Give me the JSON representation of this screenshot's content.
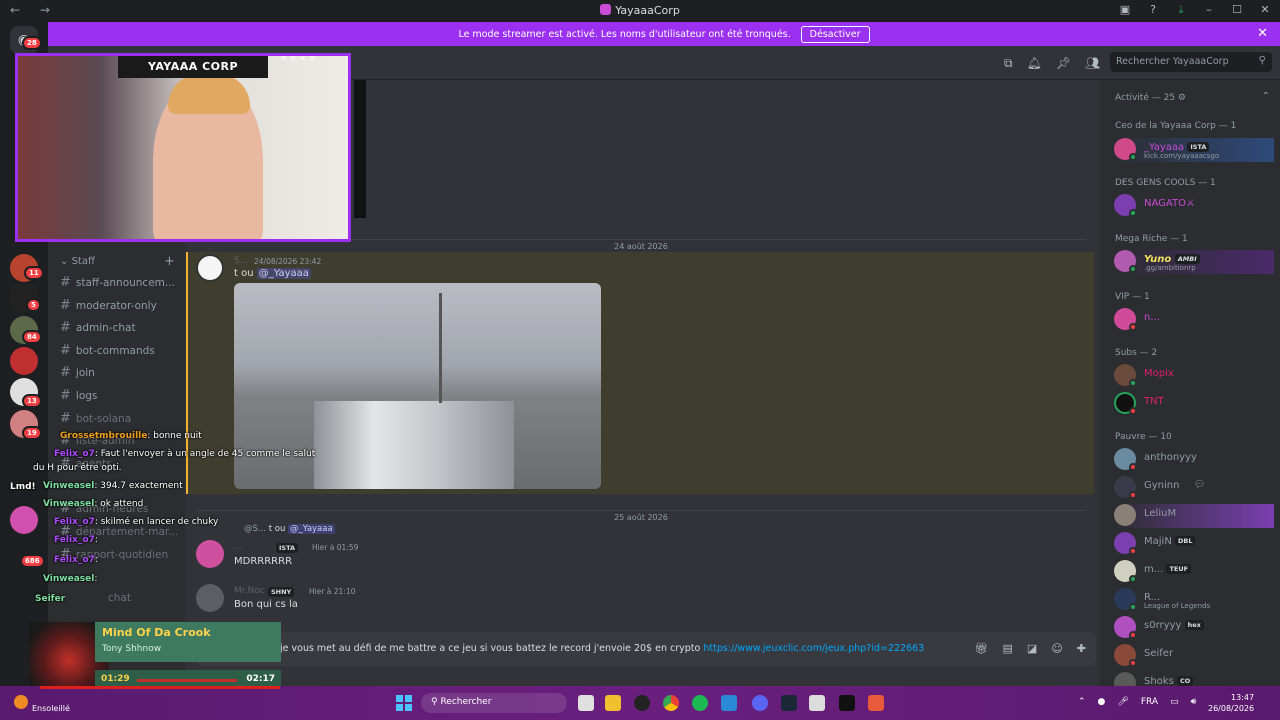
{
  "window": {
    "title": "YayaaaCorp",
    "nav": "←  →"
  },
  "banner": {
    "text": "Le mode streamer est activé. Les noms d'utilisateur ont été tronqués.",
    "button": "Désactiver"
  },
  "guilds": {
    "home_badge": "28",
    "badges": [
      "11",
      "5",
      "84",
      "13",
      "19",
      "686"
    ]
  },
  "channels": {
    "category": "Staff",
    "items": [
      "staff-announcem...",
      "moderator-only",
      "admin-chat",
      "bot-commands",
      "join",
      "logs",
      "bot-solana",
      "liste-admin",
      "agents",
      "admin-heures",
      "département-mar...",
      "rapport-quotidien",
      "chat"
    ]
  },
  "search": {
    "placeholder": "Rechercher YayaaaCorp"
  },
  "messages": {
    "date1": "24 août 2026",
    "date2": "25 août 2026",
    "m1": {
      "user": "S...",
      "time": "24/08/2026 23:42",
      "text_pre": "t ou ",
      "mention": "@_Yayaaa"
    },
    "m2": {
      "reply_user": "@S...",
      "reply_text": "t ou ",
      "reply_mention": "@_Yayaaa",
      "user": "...",
      "tag": "ISTA",
      "time": "Hier à 01:59",
      "text": "MDRRRRRR"
    },
    "m3": {
      "user": "Mr.Noc",
      "tag": "SHNY",
      "time": "Hier à 21:10",
      "text": "Bon qui cs la"
    }
  },
  "composer": {
    "text": "je vous met au défi de me battre a ce jeu si vous battez le record j'envoie 20$ en crypto ",
    "link": "https://www.jeuxclic.com/jeux.php?id=222663"
  },
  "members": {
    "activity": "Activité — 25",
    "groups": [
      {
        "header": "Ceo de la Yayaaa Corp — 1"
      },
      {
        "header": "DES GENS COOLS — 1"
      },
      {
        "header": "Mega Riche — 1"
      },
      {
        "header": "VIP — 1"
      },
      {
        "header": "Subs — 2"
      },
      {
        "header": "Pauvre — 10"
      }
    ],
    "rows": [
      {
        "name": "_Yayaaa",
        "tag": "ISTA",
        "sub": "kick.com/yayaaacsgo",
        "color": "#c94bd6"
      },
      {
        "name": "NAGATO⚔",
        "color": "#c94bd6"
      },
      {
        "name": "Yuno",
        "tag": "AMBI",
        "sub": ".gg/ambitionrp",
        "color": "#f0e05a"
      },
      {
        "name": "n...",
        "color": "#c94bd6"
      },
      {
        "name": "Mopix",
        "color": "#e0206a"
      },
      {
        "name": "TNT",
        "color": "#e0206a"
      },
      {
        "name": "anthonyyy",
        "color": "#949ba4"
      },
      {
        "name": "Gyninn",
        "color": "#949ba4"
      },
      {
        "name": "LeliuM",
        "color": "#949ba4"
      },
      {
        "name": "MajiN",
        "tag": "DBL",
        "color": "#949ba4"
      },
      {
        "name": "m...",
        "tag": "TEUF",
        "color": "#949ba4"
      },
      {
        "name": "R...",
        "sub": "League of Legends",
        "color": "#949ba4"
      },
      {
        "name": "s0rryyy",
        "tag": "hex",
        "color": "#949ba4"
      },
      {
        "name": "Seifer",
        "color": "#949ba4"
      },
      {
        "name": "Shoks",
        "tag": "CO",
        "color": "#949ba4"
      }
    ]
  },
  "overlay": {
    "webcam_title": "YAYAAA CORP",
    "chat": [
      {
        "user": "Grossetmbrouille",
        "text": ": bonne nuit",
        "color": "#f0a020"
      },
      {
        "user": "Felix_o7",
        "text": ": Faut l'envoyer à un angle de 45 comme le salut",
        "color": "#b04cff"
      },
      {
        "user": "",
        "text": "du H pour être opti.",
        "color": "#fff"
      },
      {
        "user": "Vinweasel",
        "text": ": 394.7 exactement",
        "color": "#7de0a0"
      },
      {
        "user": "Vinweasel",
        "text": ": ok attend",
        "color": "#7de0a0"
      },
      {
        "user": "Felix_o7",
        "text": ": skilmé en lancer de chuky",
        "color": "#b04cff"
      },
      {
        "user": "Felix_o7",
        "text": ":",
        "color": "#b04cff"
      },
      {
        "user": "Felix_o7",
        "text": ":",
        "color": "#b04cff"
      },
      {
        "user": "Vinweasel",
        "text": ":",
        "color": "#7de0a0"
      },
      {
        "user": "Seifer",
        "text": "",
        "color": "#7de0a0"
      }
    ],
    "lmd": "Lmd!",
    "nowplaying": {
      "title": "Mind Of Da Crook",
      "artist": "Tony Shhnow",
      "elapsed": "01:29",
      "total": "02:17"
    }
  },
  "taskbar": {
    "weather": "Ensoleillé",
    "search": "Rechercher",
    "lang": "FRA",
    "time": "13:47",
    "date": "26/08/2026"
  },
  "colors": {
    "accent": "#9b30f0",
    "highlight": "#f0b232",
    "link": "#00a8fc"
  }
}
